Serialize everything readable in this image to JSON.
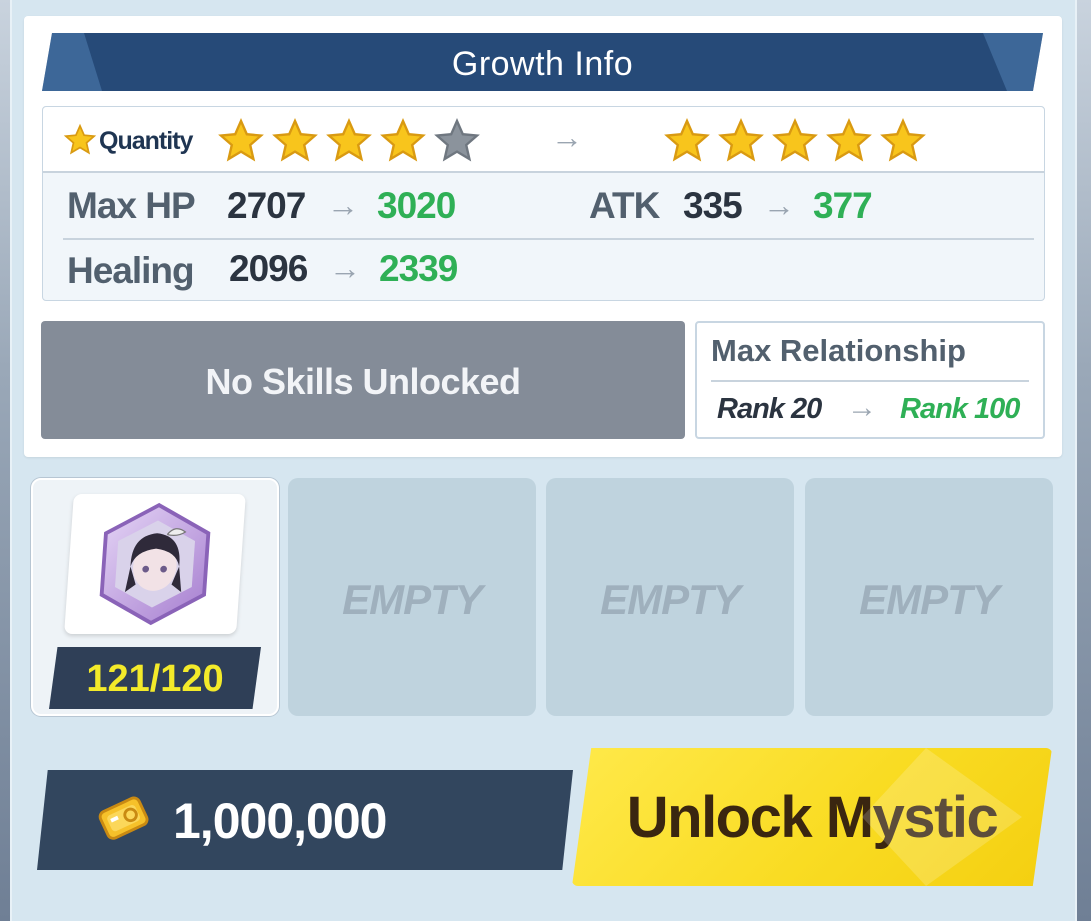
{
  "header": {
    "title": "Growth Info"
  },
  "stars": {
    "label": "Quantity",
    "current_filled": 4,
    "current_total": 5,
    "next_filled": 5,
    "next_total": 5,
    "filled_color": "#f8c51c",
    "empty_color": "#8b939c"
  },
  "stats": [
    {
      "label": "Max HP",
      "old": "2707",
      "new": "3020"
    },
    {
      "label": "ATK",
      "old": "335",
      "new": "377"
    },
    {
      "label": "Healing",
      "old": "2096",
      "new": "2339"
    }
  ],
  "skills": {
    "text": "No Skills Unlocked"
  },
  "relationship": {
    "title": "Max Relationship",
    "old": "Rank 20",
    "new": "Rank 100"
  },
  "slots": {
    "filled": {
      "count": "121/120",
      "icon": "student-portrait-icon"
    },
    "empty_label": "EMPTY"
  },
  "cost": {
    "icon": "credit-coin-icon",
    "amount": "1,000,000"
  },
  "unlock_button": {
    "label": "Unlock Mystic"
  },
  "colors": {
    "accent_green": "#2fb056",
    "banner": "#264a78",
    "button_yellow": "#f9dc23",
    "count_yellow": "#f3ea2a"
  }
}
